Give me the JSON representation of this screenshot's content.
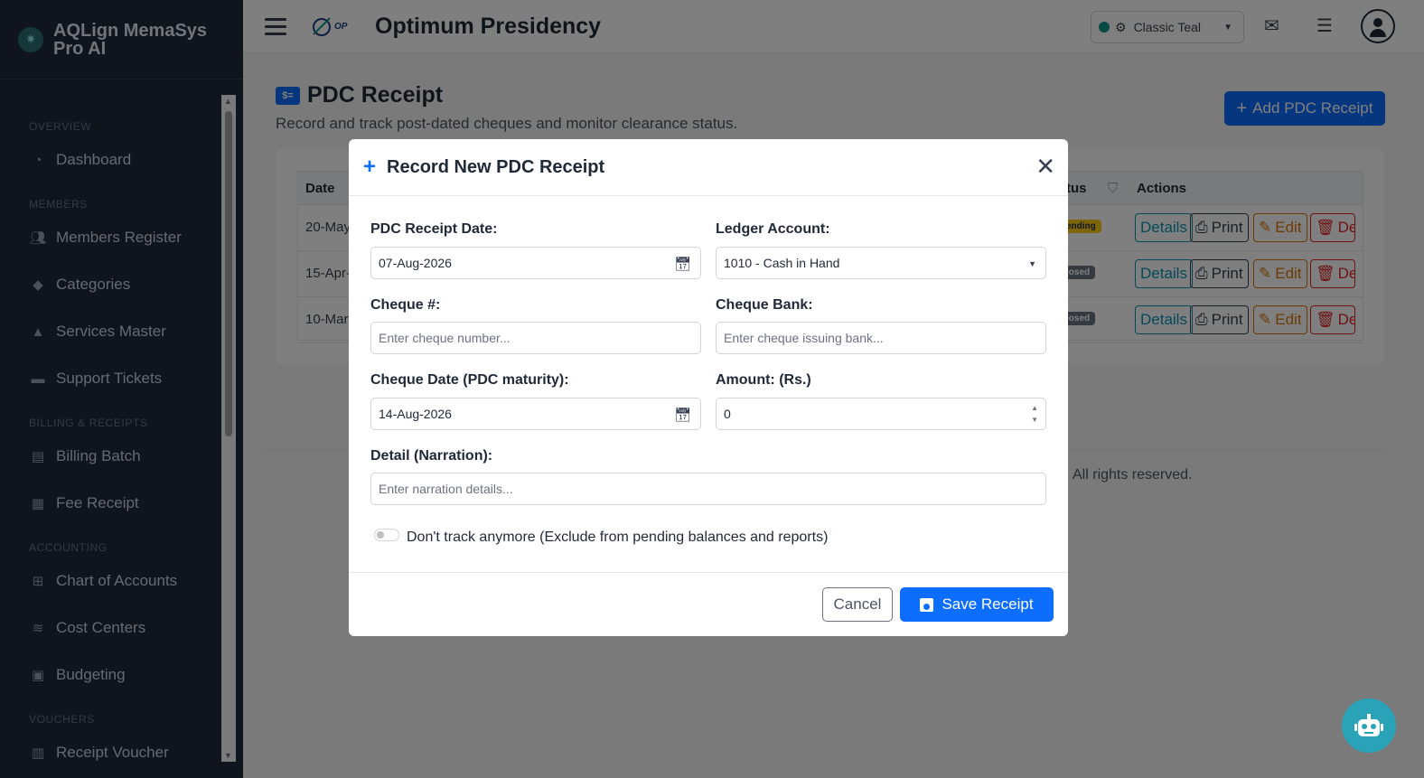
{
  "brand": {
    "name_line1": "AQLign MemaSys",
    "name_line2": "Pro AI"
  },
  "sidebar": {
    "sections": [
      {
        "title": "OVERVIEW",
        "items": [
          {
            "label": "Dashboard",
            "icon": "pie-chart-icon"
          }
        ]
      },
      {
        "title": "MEMBERS",
        "items": [
          {
            "label": "Members Register",
            "icon": "users-icon"
          },
          {
            "label": "Categories",
            "icon": "tags-icon"
          },
          {
            "label": "Services Master",
            "icon": "bell-concierge-icon"
          },
          {
            "label": "Support Tickets",
            "icon": "ticket-icon"
          }
        ]
      },
      {
        "title": "BILLING & RECEIPTS",
        "items": [
          {
            "label": "Billing Batch",
            "icon": "file-invoice-icon"
          },
          {
            "label": "Fee Receipt",
            "icon": "cash-register-icon"
          }
        ]
      },
      {
        "title": "ACCOUNTING",
        "items": [
          {
            "label": "Chart of Accounts",
            "icon": "sitemap-icon"
          },
          {
            "label": "Cost Centers",
            "icon": "layer-group-icon"
          },
          {
            "label": "Budgeting",
            "icon": "money-bill-icon"
          }
        ]
      },
      {
        "title": "VOUCHERS",
        "items": [
          {
            "label": "Receipt Voucher",
            "icon": "receipt-icon"
          }
        ]
      }
    ]
  },
  "header": {
    "app_title": "Optimum Presidency",
    "logo_text": "OP",
    "theme": {
      "label": "Classic Teal",
      "dot_color": "#0d9488"
    }
  },
  "page": {
    "title": "PDC Receipt",
    "title_icon_text": "$=",
    "subtitle": "Record and track post-dated cheques and monitor clearance status.",
    "add_button": "Add PDC Receipt",
    "table": {
      "headers": {
        "date": "Date",
        "status": "tus",
        "actions": "Actions"
      },
      "rows": [
        {
          "date": "20-May",
          "status": "ending",
          "status_kind": "pending"
        },
        {
          "date": "15-Apr-",
          "status": "losed",
          "status_kind": "closed"
        },
        {
          "date": "10-Mar-",
          "status": "losed",
          "status_kind": "closed"
        }
      ],
      "actions": {
        "details": "Details",
        "print": "Print",
        "edit": "Edit",
        "delete": "Dele"
      }
    },
    "footer_text": ". All rights reserved."
  },
  "modal": {
    "title": "Record New PDC Receipt",
    "fields": {
      "receipt_date": {
        "label": "PDC Receipt Date:",
        "value": "07-Aug-2026"
      },
      "ledger_account": {
        "label": "Ledger Account:",
        "value": "1010 - Cash in Hand"
      },
      "cheque_no": {
        "label": "Cheque #:",
        "placeholder": "Enter cheque number..."
      },
      "cheque_bank": {
        "label": "Cheque Bank:",
        "placeholder": "Enter cheque issuing bank..."
      },
      "cheque_date": {
        "label": "Cheque Date (PDC maturity):",
        "value": "14-Aug-2026"
      },
      "amount": {
        "label": "Amount: (Rs.)",
        "value": "0"
      },
      "narration": {
        "label": "Detail (Narration):",
        "placeholder": "Enter narration details..."
      }
    },
    "toggle_label": "Don't track anymore (Exclude from pending balances and reports)",
    "cancel_label": "Cancel",
    "save_label": "Save Receipt"
  }
}
